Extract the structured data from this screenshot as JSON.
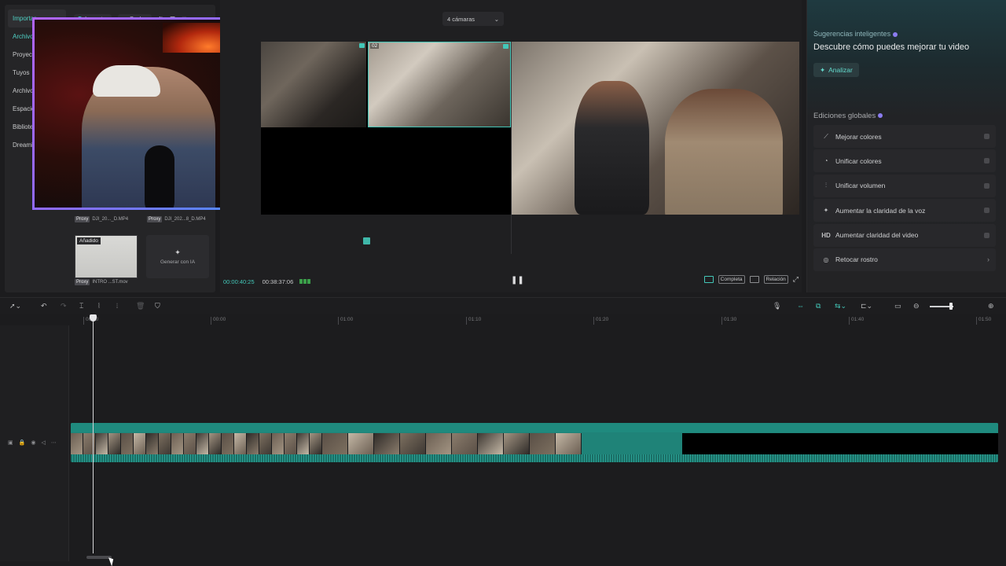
{
  "left_nav": {
    "items": [
      {
        "label": "Importar",
        "active": true
      },
      {
        "label": "Archivo",
        "active": false
      },
      {
        "label": "Proyectos",
        "active": false
      },
      {
        "label": "Tuyos",
        "active": false
      },
      {
        "label": "Archivo",
        "active": false
      },
      {
        "label": "Espacio",
        "active": false
      },
      {
        "label": "Biblioteca",
        "active": false
      },
      {
        "label": "Dreamina",
        "active": false
      }
    ]
  },
  "media_toolbar": {
    "import_label": "Importar",
    "record_label": "Grabar",
    "sort_icon": "sort-icon",
    "view_icon": "list-view-icon",
    "filter_icon": "filter-icon"
  },
  "media": {
    "thumb1_label": "DJI_20..._D.MP4",
    "thumb2_label": "DJI_202...8_D.MP4",
    "thumb3_label": "INTRO ...ST.mov",
    "proxy_tag": "Proxy",
    "added_tag": "Añadido",
    "gen_ai_label": "Generar con IA"
  },
  "preview": {
    "camera_select": "4 cámaras",
    "cam_selected_num": "02",
    "timecode_current": "00:00:40:25",
    "timecode_total": "00:38:37:06",
    "play_state": "pause",
    "complete_label": "Completa",
    "ratio_label": "Relación"
  },
  "smart_panel": {
    "heading_small": "Sugerencias inteligentes",
    "heading": "Descubre cómo puedes mejorar tu video",
    "analyze_label": "Analizar",
    "global_edits_label": "Ediciones globales",
    "items": [
      {
        "label": "Mejorar colores",
        "icon": "magic-wand-icon",
        "glyph": "⟋"
      },
      {
        "label": "Unificar colores",
        "icon": "color-match-icon",
        "glyph": "◔"
      },
      {
        "label": "Unificar volumen",
        "icon": "sliders-icon",
        "glyph": "⫶"
      },
      {
        "label": "Aumentar la claridad de la voz",
        "icon": "sparkle-voice-icon",
        "glyph": "✦"
      },
      {
        "label": "Aumentar claridad del video",
        "icon": "hd-icon",
        "glyph": "HD"
      },
      {
        "label": "Retocar rostro",
        "icon": "face-retouch-icon",
        "glyph": "◎"
      }
    ]
  },
  "timeline": {
    "ruler_ticks": [
      "00:00",
      "00:00",
      "01:00",
      "01:10",
      "01:20",
      "01:30",
      "01:40",
      "01:50"
    ]
  },
  "colors": {
    "accent": "#43c7b8",
    "clip": "#1f8378",
    "webcam_border": "#9b6bff"
  }
}
